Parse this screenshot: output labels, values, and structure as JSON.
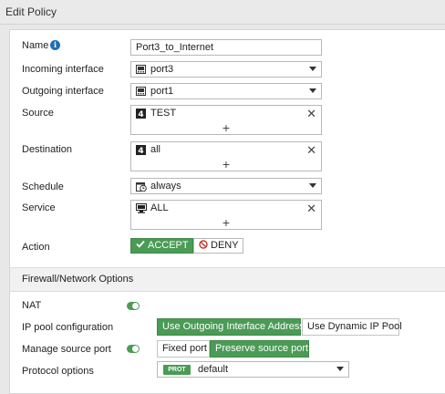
{
  "window": {
    "title": "Edit Policy"
  },
  "form": {
    "name": {
      "label": "Name",
      "value": "Port3_to_Internet"
    },
    "incoming": {
      "label": "Incoming interface",
      "value": "port3"
    },
    "outgoing": {
      "label": "Outgoing interface",
      "value": "port1"
    },
    "source": {
      "label": "Source",
      "value": "TEST",
      "add": "+"
    },
    "destination": {
      "label": "Destination",
      "value": "all",
      "add": "+"
    },
    "schedule": {
      "label": "Schedule",
      "value": "always"
    },
    "service": {
      "label": "Service",
      "value": "ALL",
      "add": "+"
    },
    "action": {
      "label": "Action",
      "accept": "ACCEPT",
      "deny": "DENY",
      "selected": "ACCEPT"
    }
  },
  "firewall": {
    "section_title": "Firewall/Network Options",
    "nat": {
      "label": "NAT",
      "enabled": true
    },
    "ip_pool": {
      "label": "IP pool configuration",
      "options": [
        "Use Outgoing Interface Address",
        "Use Dynamic IP Pool"
      ],
      "selected": "Use Outgoing Interface Address"
    },
    "source_port": {
      "label": "Manage source port",
      "enabled": true,
      "options": [
        "Fixed port",
        "Preserve source port"
      ],
      "selected": "Preserve source port"
    },
    "protocol": {
      "label": "Protocol options",
      "badge": "PROT",
      "value": "default"
    }
  },
  "colors": {
    "accent": "#4a9b55",
    "info": "#1f6fb5"
  }
}
